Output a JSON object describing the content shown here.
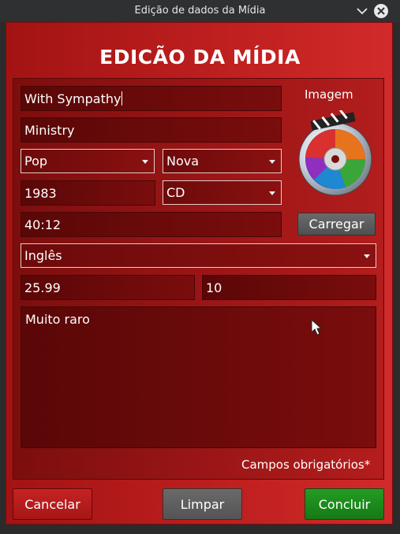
{
  "window": {
    "title": "Edição de dados da Mídia"
  },
  "form": {
    "heading": "EDICÃO DA MÍDIA",
    "title_value": "With Sympathy",
    "artist_value": "Ministry",
    "genre_value": "Pop",
    "condition_value": "Nova",
    "year_value": "1983",
    "media_type_value": "CD",
    "duration_value": "40:12",
    "language_value": "Inglês",
    "price_value": "25.99",
    "quantity_value": "10",
    "notes_value": "Muito raro",
    "image_label": "Imagem",
    "load_button": "Carregar",
    "required_note": "Campos obrigatórios*"
  },
  "actions": {
    "cancel": "Cancelar",
    "clear": "Limpar",
    "confirm": "Concluir"
  },
  "icons": {
    "minimize": "chevron-down-icon",
    "close": "close-icon",
    "media": "media-disc-icon"
  },
  "colors": {
    "accent_red": "#c02020",
    "confirm_green": "#1f8c1f",
    "neutral_button": "#5c5c5c"
  }
}
